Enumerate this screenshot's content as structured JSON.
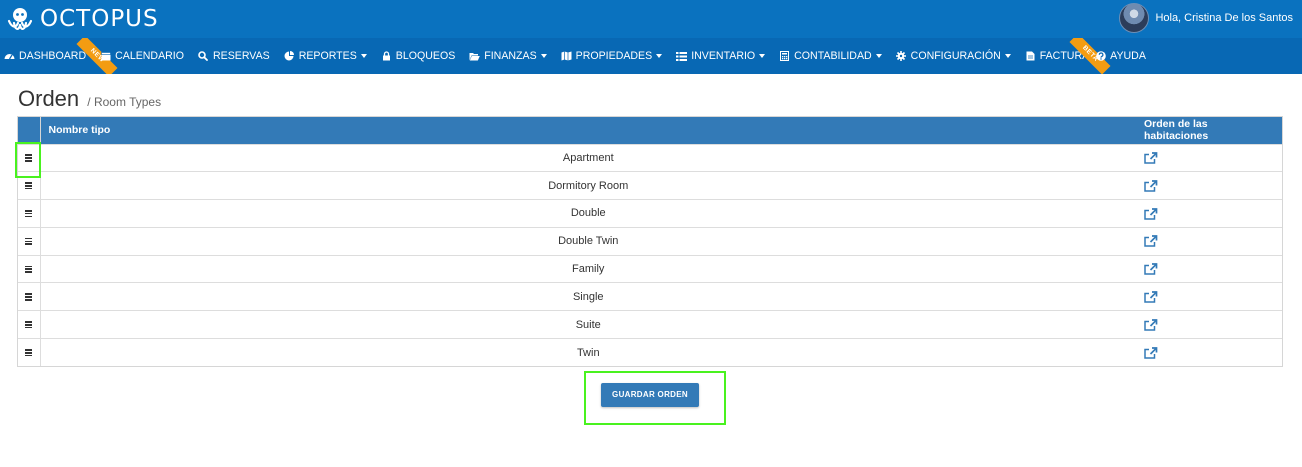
{
  "app": {
    "brand": "OCTOPUS",
    "brand_color": "#0a72bf"
  },
  "user": {
    "greeting": "Hola, Cristina De los Santos"
  },
  "nav": {
    "items": [
      {
        "label": "DASHBOARD",
        "icon": "dashboard-icon",
        "dropdown": false,
        "ribbon": "NEW"
      },
      {
        "label": "CALENDARIO",
        "icon": "calendar-icon",
        "dropdown": false
      },
      {
        "label": "RESERVAS",
        "icon": "search-icon",
        "dropdown": false
      },
      {
        "label": "REPORTES",
        "icon": "pie-chart-icon",
        "dropdown": true
      },
      {
        "label": "BLOQUEOS",
        "icon": "lock-icon",
        "dropdown": false
      },
      {
        "label": "FINANZAS",
        "icon": "folder-open-icon",
        "dropdown": true
      },
      {
        "label": "PROPIEDADES",
        "icon": "map-icon",
        "dropdown": true
      },
      {
        "label": "INVENTARIO",
        "icon": "list-icon",
        "dropdown": true
      },
      {
        "label": "CONTABILIDAD",
        "icon": "calculator-icon",
        "dropdown": true
      },
      {
        "label": "CONFIGURACIÓN",
        "icon": "gear-icon",
        "dropdown": true
      },
      {
        "label": "FACTURA",
        "icon": "file-icon",
        "dropdown": false,
        "ribbon": "BETA"
      },
      {
        "label": "AYUDA",
        "icon": "question-circle-icon",
        "dropdown": false
      }
    ]
  },
  "page": {
    "title": "Orden",
    "subtitle": "/ Room Types"
  },
  "table": {
    "columns": {
      "name": "Nombre tipo",
      "order": "Orden de las habitaciones"
    },
    "rows": [
      {
        "name": "Apartment"
      },
      {
        "name": "Dormitory Room"
      },
      {
        "name": "Double"
      },
      {
        "name": "Double Twin"
      },
      {
        "name": "Family"
      },
      {
        "name": "Single"
      },
      {
        "name": "Suite"
      },
      {
        "name": "Twin"
      }
    ]
  },
  "actions": {
    "save_label": "GUARDAR ORDEN"
  },
  "colors": {
    "topbar": "#0a72bf",
    "navbar": "#0868b4",
    "header": "#337ab7",
    "link": "#337ab7",
    "highlight": "#49f21f",
    "ribbon": "#f39c12"
  }
}
